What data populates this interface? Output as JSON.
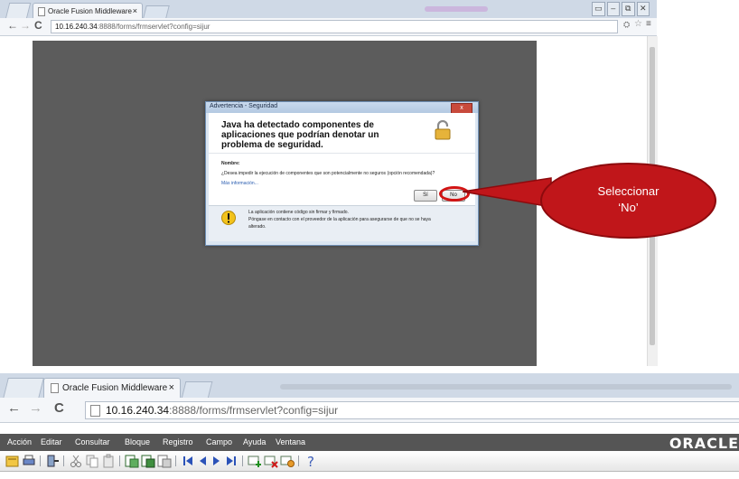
{
  "browser_top": {
    "tab": {
      "title": "Oracle Fusion Middleware",
      "close": "×"
    },
    "url": {
      "host": "10.16.240.34",
      "path": ":8888/forms/frmservlet?config=sijur"
    },
    "window_buttons": [
      "▭",
      "–",
      "⧉",
      "✕"
    ]
  },
  "dialog": {
    "title": "Advertencia - Seguridad",
    "close": "x",
    "heading": "Java ha detectado componentes de aplicaciones que podrían denotar un problema de seguridad.",
    "name_label": "Nombre:",
    "question": "¿Desea impedir la ejecución de componentes que son potencialmente no seguros (opción recomendada)?",
    "more_info": "Más información...",
    "btn_yes": "Sí",
    "btn_no": "No",
    "warning_line1": "La aplicación contiene código sin firmar y firmado.",
    "warning_line2": "Póngase en contacto con el proveedor de la aplicación para asegurarse de que no se haya",
    "warning_line3": "alterado."
  },
  "callout": {
    "line1": "Seleccionar",
    "line2": "‘No’"
  },
  "browser_bottom": {
    "tab": {
      "title": "Oracle Fusion Middleware",
      "close": "×"
    },
    "url": {
      "host": "10.16.240.34",
      "path": ":8888/forms/frmservlet?config=sijur"
    }
  },
  "app_menu": {
    "items": [
      "Acción",
      "Editar",
      "Consultar",
      "Bloque",
      "Registro",
      "Campo",
      "Ayuda",
      "Ventana"
    ],
    "brand": "ORACLE"
  },
  "icons": {
    "toolbar": [
      "save-icon",
      "print-icon",
      "exit-icon",
      "cut-icon",
      "copy-icon",
      "paste-icon",
      "enter-query-icon",
      "execute-query-icon",
      "cancel-query-icon",
      "first-record-icon",
      "previous-record-icon",
      "next-record-icon",
      "last-record-icon",
      "insert-record-icon",
      "delete-record-icon",
      "lock-record-icon",
      "help-icon"
    ]
  },
  "colors": {
    "callout": "#c0161a",
    "menubar": "#555555",
    "stage": "#5c5c5c"
  }
}
